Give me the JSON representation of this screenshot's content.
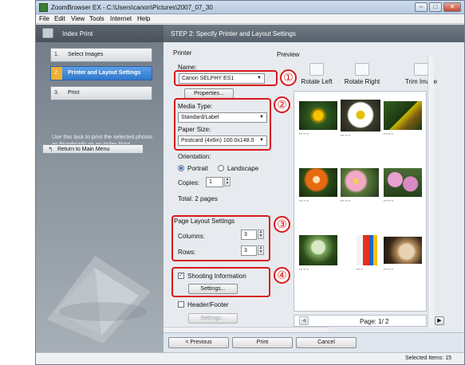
{
  "window": {
    "title": "ZoomBrowser EX  -  C:\\Users\\canon\\Pictures\\2007_07_30",
    "menu": [
      "File",
      "Edit",
      "View",
      "Tools",
      "Internet",
      "Help"
    ]
  },
  "sidebar": {
    "title": "Index Print",
    "steps": [
      {
        "num": "1.",
        "label": "Select Images"
      },
      {
        "num": "2.",
        "label": "Printer and Layout Settings"
      },
      {
        "num": "3.",
        "label": "Print"
      }
    ],
    "description": "Use this task to print the selected photos as thumbnails on an Index Print.",
    "return_label": "Return to Main Menu"
  },
  "header": {
    "title": "STEP 2: Specify Printer and Layout Settings"
  },
  "printer": {
    "section": "Printer",
    "name_label": "Name:",
    "name_value": "Canon SELPHY ES1",
    "properties_label": "Properties...",
    "media_type_label": "Media Type:",
    "media_type_value": "Standard/Label",
    "paper_size_label": "Paper Size:",
    "paper_size_value": "Postcard (4x6in) 100.0x148.0",
    "orientation_label": "Orientation:",
    "portrait_label": "Portrait",
    "landscape_label": "Landscape",
    "copies_label": "Copies:",
    "copies_value": "1",
    "total": "Total: 2 pages"
  },
  "layout": {
    "section": "Page Layout Settings",
    "columns_label": "Columns:",
    "columns_value": "3",
    "rows_label": "Rows:",
    "rows_value": "3"
  },
  "shooting": {
    "label": "Shooting Information",
    "settings_label": "Settings..."
  },
  "header_footer": {
    "label": "Header/Footer",
    "settings_label": "Settings..."
  },
  "preview": {
    "section": "Preview",
    "rotate_left": "Rotate Left",
    "rotate_right": "Rotate Right",
    "trim_image": "Trim Image",
    "page_text": "Page: 1/ 2"
  },
  "annotations": [
    "①",
    "②",
    "③",
    "④"
  ],
  "bottom": {
    "previous": "< Previous",
    "print": "Print",
    "cancel": "Cancel"
  },
  "status": {
    "selected": "Selected Items: 15"
  },
  "colors": {
    "accent_red": "#d91a1a",
    "active_step": "#2f78cc"
  }
}
